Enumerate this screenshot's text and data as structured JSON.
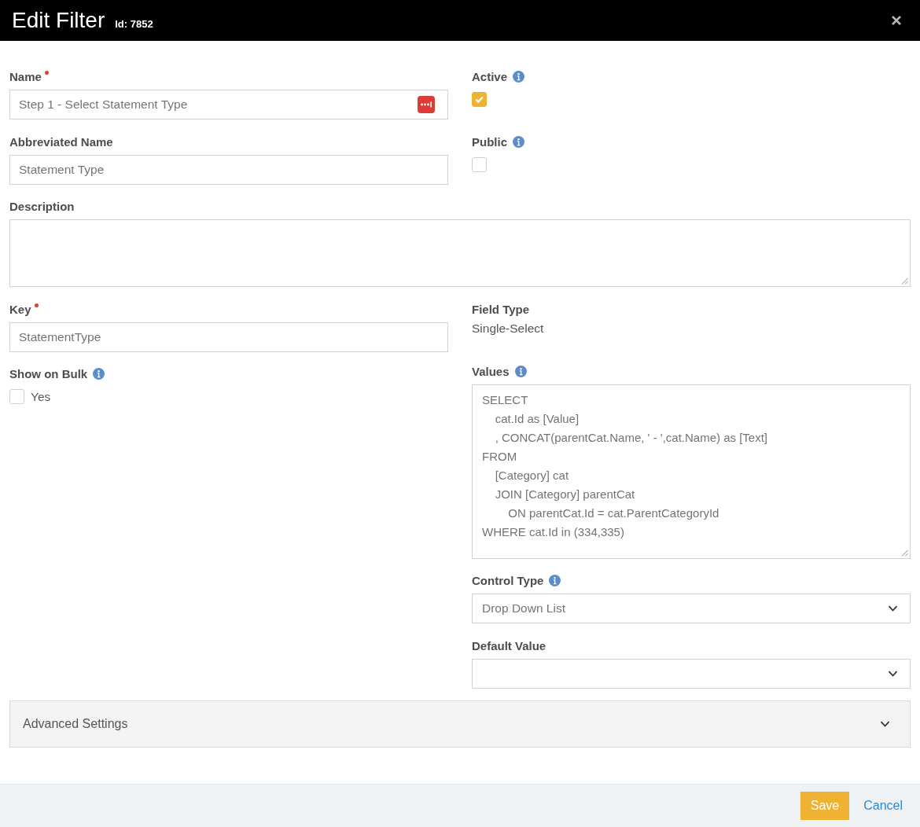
{
  "dialog": {
    "title": "Edit Filter",
    "id_text": "Id: 7852"
  },
  "upper_left": [
    {
      "kind": "text",
      "label": "Name",
      "required": true,
      "info": false,
      "value": "Step 1 - Select Statement Type",
      "field_icon": true
    },
    {
      "kind": "text",
      "label": "Abbreviated Name",
      "required": false,
      "info": false,
      "value": "Statement Type",
      "field_icon": false
    }
  ],
  "upper_right": [
    {
      "kind": "checkbox",
      "label": "Active",
      "required": false,
      "info": true,
      "checked": true
    },
    {
      "kind": "checkbox",
      "label": "Public",
      "required": false,
      "info": true,
      "checked": false
    }
  ],
  "description": {
    "kind": "textarea",
    "label": "Description",
    "required": false,
    "info": false
  },
  "lower_left": [
    {
      "kind": "text",
      "label": "Key",
      "required": true,
      "info": false,
      "value": "StatementType",
      "field_icon": false
    },
    {
      "kind": "checkbox",
      "label": "Show on Bulk",
      "required": false,
      "info": true,
      "checked": false,
      "option": "Yes"
    }
  ],
  "lower_right": [
    {
      "kind": "static",
      "label": "Field Type",
      "required": false,
      "info": false,
      "value": "Single-Select"
    },
    {
      "kind": "textarea",
      "label": "Values",
      "required": false,
      "info": true,
      "value": "SELECT\n    cat.Id as [Value]\n    , CONCAT(parentCat.Name, ' - ',cat.Name) as [Text]\nFROM\n    [Category] cat\n    JOIN [Category] parentCat\n        ON parentCat.Id = cat.ParentCategoryId\nWHERE cat.Id in (334,335)"
    },
    {
      "kind": "select",
      "label": "Control Type",
      "required": false,
      "info": true,
      "value": "Drop Down List"
    },
    {
      "kind": "select",
      "label": "Default Value",
      "required": false,
      "info": false
    }
  ],
  "advanced_settings": {
    "label": "Advanced Settings",
    "expanded": false
  },
  "footer": {
    "buttons": [
      {
        "kind": "primary",
        "label": "Save"
      },
      {
        "kind": "link",
        "label": "Cancel"
      }
    ]
  }
}
